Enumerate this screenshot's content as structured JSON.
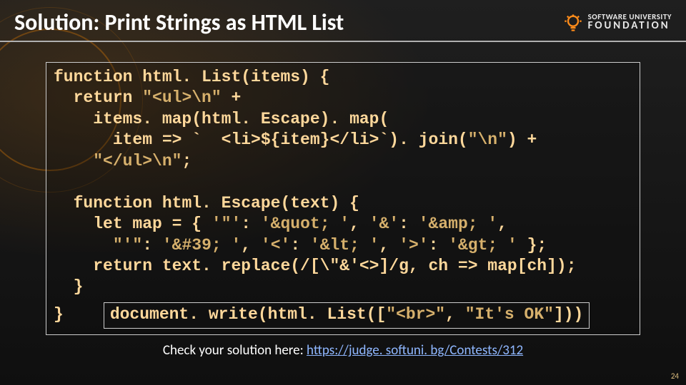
{
  "header": {
    "title": "Solution: Print Strings as HTML List",
    "logo_line1": "SOFTWARE UNIVERSITY",
    "logo_line2": "FOUNDATION"
  },
  "code": {
    "l1a": "function",
    "l1b": " html. List(items) {",
    "l2a": "  return ",
    "l2b": "\"<ul>\\n\"",
    "l2c": " +",
    "l3a": "    items. map(html. Escape). map(",
    "l4a": "      item => `  <li>${item}</li>`). join(",
    "l4b": "\"\\n\"",
    "l4c": ") +",
    "l5a": "    ",
    "l5b": "\"</ul>\\n\"",
    "l5c": ";",
    "l6a": "  function",
    "l6b": " html. Escape(text) {",
    "l7a": "    let map = { ",
    "l7b": "'\"'",
    "l7c": ": ",
    "l7d": "'&quot; '",
    "l7e": ", ",
    "l7f": "'&'",
    "l7g": ": ",
    "l7h": "'&amp; '",
    "l7i": ",",
    "l8a": "      ",
    "l8b": "\"'\"",
    "l8c": ": ",
    "l8d": "'&#39; '",
    "l8e": ", ",
    "l8f": "'<'",
    "l8g": ": ",
    "l8h": "'&lt; '",
    "l8i": ", ",
    "l8j": "'>'",
    "l8k": ": ",
    "l8l": "'&gt; '",
    "l8m": " };",
    "l9a": "    return text. replace(/[\\\"&'<>]/g, ch => map[ch]);",
    "l10": "  }",
    "l11": "}",
    "inner_a": "document. write(html. List([",
    "inner_b": "\"<br>\"",
    "inner_c": ", ",
    "inner_d": "\"It's OK\"",
    "inner_e": "]))"
  },
  "footer": {
    "text": "Check your solution here: ",
    "link_text": "https://judge. softuni. bg/Contests/312",
    "link_href": "https://judge.softuni.bg/Contests/312"
  },
  "page_number": "24"
}
